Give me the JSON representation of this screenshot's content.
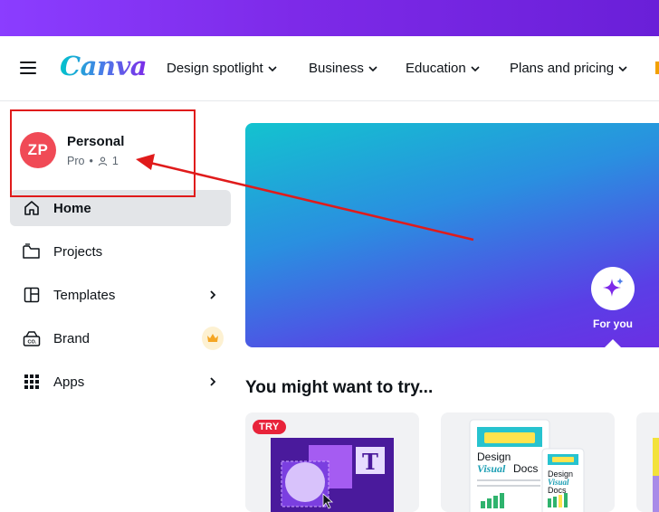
{
  "brand": {
    "logo_text": "Canva",
    "accent": "#8b3dff",
    "gradient_start": "#00c4cc"
  },
  "nav": {
    "menu_icon": "hamburger-icon",
    "items": [
      {
        "label": "Design spotlight"
      },
      {
        "label": "Business"
      },
      {
        "label": "Education"
      },
      {
        "label": "Plans and pricing"
      }
    ]
  },
  "account": {
    "initials": "ZP",
    "name": "Personal",
    "plan": "Pro",
    "separator": "•",
    "members": "1",
    "avatar_color": "#f04a56"
  },
  "sidebar": {
    "items": [
      {
        "label": "Home",
        "icon": "home-icon",
        "active": true
      },
      {
        "label": "Projects",
        "icon": "folder-icon"
      },
      {
        "label": "Templates",
        "icon": "templates-icon",
        "right": "chevron-right-icon"
      },
      {
        "label": "Brand",
        "icon": "brand-kit-icon",
        "right": "crown-icon"
      },
      {
        "label": "Apps",
        "icon": "apps-grid-icon",
        "right": "chevron-right-icon"
      }
    ]
  },
  "hero": {
    "for_you_label": "For you",
    "icon": "sparkle-icon"
  },
  "suggestions": {
    "title": "You might want to try...",
    "cards": [
      {
        "badge": "TRY",
        "glyph": "T"
      },
      {
        "heading_line1": "Design",
        "heading_visual": "Visual",
        "heading_docs": "Docs",
        "small_line1": "Design",
        "small_visual": "Visual",
        "small_docs": "Docs"
      }
    ]
  },
  "annotation_color": "#e01b1b"
}
